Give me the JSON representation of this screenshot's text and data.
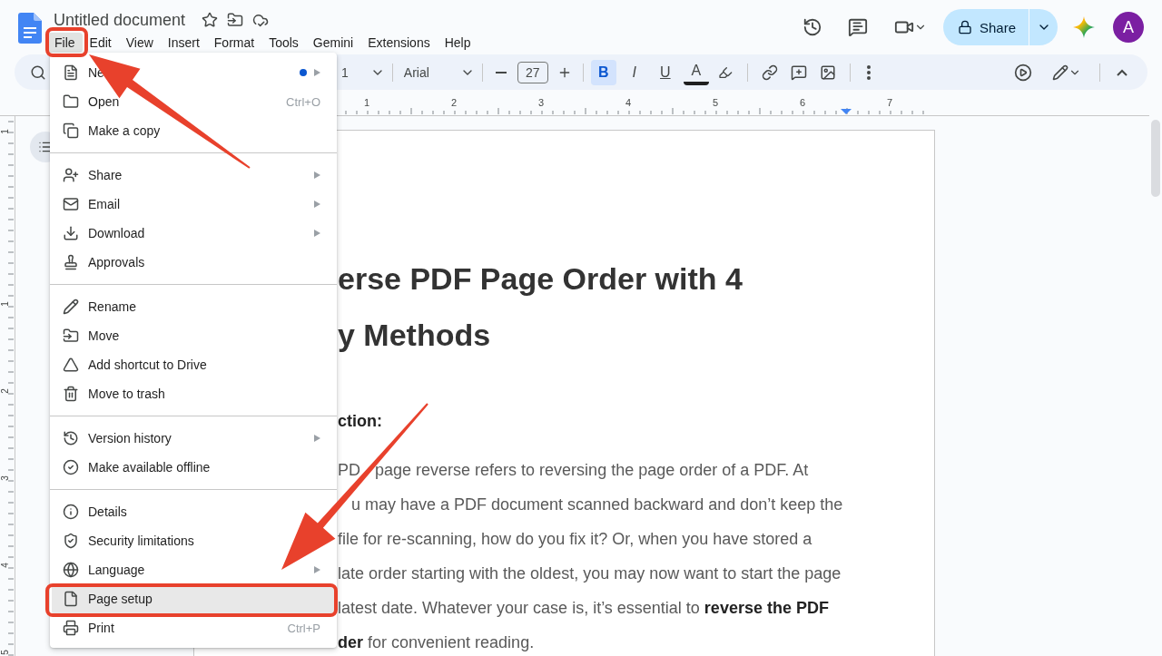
{
  "header": {
    "title": "Untitled document",
    "menus": [
      {
        "label": "File",
        "selected": true
      },
      {
        "label": "Edit",
        "selected": false
      },
      {
        "label": "View",
        "selected": false
      },
      {
        "label": "Insert",
        "selected": false
      },
      {
        "label": "Format",
        "selected": false
      },
      {
        "label": "Tools",
        "selected": false
      },
      {
        "label": "Gemini",
        "selected": false
      },
      {
        "label": "Extensions",
        "selected": false
      },
      {
        "label": "Help",
        "selected": false
      }
    ],
    "share": "Share",
    "avatar": "A"
  },
  "toolbar": {
    "style_fragment": "1",
    "font": "Arial",
    "font_size": "27",
    "format_buttons": [
      {
        "label": "B",
        "selected": true
      },
      {
        "label": "I",
        "selected": false
      },
      {
        "label": "U",
        "selected": false
      },
      {
        "label": "A",
        "selected": false
      }
    ]
  },
  "ruler": {
    "marks": [
      "1",
      "2",
      "3",
      "4",
      "5",
      "6",
      "7"
    ]
  },
  "side_ruler": {
    "marks": [
      "1",
      "1",
      "2",
      "3",
      "4",
      "5"
    ]
  },
  "document": {
    "heading_lines": [
      "erse PDF Page Order with 4",
      "y Methods"
    ],
    "subheading": "ction:",
    "paragraph_lines": [
      [
        "PD",
        "page reverse refers to reversing the page order of a PDF. At"
      ],
      [
        "u may have a PDF document scanned backward and don’t keep the"
      ],
      [
        "file for re-scanning, how do you fix it? Or, when you have stored a"
      ],
      [
        "late order starting with the oldest, you may now want to start the page"
      ],
      [
        "latest date. Whatever your case is, it’s essential to **reverse the PDF**"
      ],
      [
        "**der** for convenient reading."
      ]
    ]
  },
  "file_menu": {
    "groups": [
      [
        {
          "label": "Ne",
          "submenu": true,
          "dot": true,
          "selected": false
        },
        {
          "label": "Open",
          "shortcut": "Ctrl+O",
          "submenu": false,
          "dot": false,
          "selected": false
        },
        {
          "label": "Make a copy",
          "submenu": false,
          "dot": false,
          "selected": false
        }
      ],
      [
        {
          "label": "Share",
          "submenu": true,
          "dot": false,
          "selected": false
        },
        {
          "label": "Email",
          "submenu": true,
          "dot": false,
          "selected": false
        },
        {
          "label": "Download",
          "submenu": true,
          "dot": false,
          "selected": false
        },
        {
          "label": "Approvals",
          "submenu": false,
          "dot": false,
          "selected": false
        }
      ],
      [
        {
          "label": "Rename",
          "submenu": false,
          "dot": false,
          "selected": false
        },
        {
          "label": "Move",
          "submenu": false,
          "dot": false,
          "selected": false
        },
        {
          "label": "Add shortcut to Drive",
          "submenu": false,
          "dot": false,
          "selected": false
        },
        {
          "label": "Move to trash",
          "submenu": false,
          "dot": false,
          "selected": false
        }
      ],
      [
        {
          "label": "Version history",
          "submenu": true,
          "dot": false,
          "selected": false
        },
        {
          "label": "Make available offline",
          "submenu": false,
          "dot": false,
          "selected": false
        }
      ],
      [
        {
          "label": "Details",
          "submenu": false,
          "dot": false,
          "selected": false
        },
        {
          "label": "Security limitations",
          "submenu": false,
          "dot": false,
          "selected": false
        },
        {
          "label": "Language",
          "submenu": true,
          "dot": false,
          "selected": false
        },
        {
          "label": "Page setup",
          "submenu": false,
          "dot": false,
          "selected": true
        },
        {
          "label": "Print",
          "shortcut": "Ctrl+P",
          "submenu": false,
          "dot": false,
          "selected": false
        }
      ]
    ]
  }
}
